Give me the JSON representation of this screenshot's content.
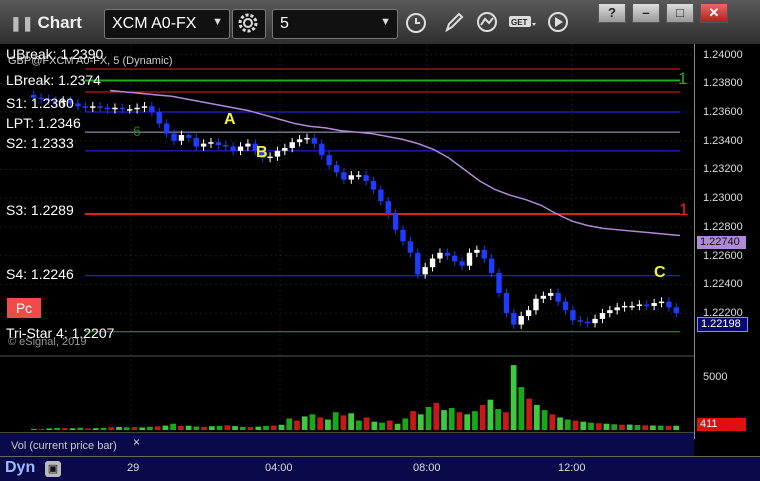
{
  "window": {
    "title": "Chart",
    "symbol": "XCM A0-FX",
    "interval": "5"
  },
  "study_label": "GBP@FXCM A0-FX, 5 (Dynamic)",
  "levels": {
    "break_top": "UBreak: 1.2390",
    "lbreak": "LBreak: 1.2374",
    "s1": "S1: 1.2360",
    "lpt": "LPT: 1.2346",
    "s2": "S2: 1.2333",
    "s3": "S3: 1.2289",
    "s4": "S4: 1.2246",
    "tristar": "Tri-Star 4: 1.2207"
  },
  "markers": {
    "a": "A",
    "b": "B",
    "c": "C",
    "one_top": "1",
    "one_mid": "1",
    "small": "6"
  },
  "badge": "Pc",
  "watermark": "© eSignal, 2019",
  "price_axis": {
    "ticks": [
      "1.24000",
      "1.23800",
      "1.23600",
      "1.23400",
      "1.23200",
      "1.23000",
      "1.22800",
      "1.22600",
      "1.22400",
      "1.22200"
    ],
    "ma_value": "1.22740",
    "last_price": "1.22198",
    "volume_tick": "5000",
    "volume_last": "411"
  },
  "volume_pane": {
    "label": "Vol (current price bar)",
    "close": "×"
  },
  "time_axis": {
    "labels": [
      "29",
      "04:00",
      "08:00",
      "12:00"
    ],
    "mode": "Dyn"
  },
  "colors": {
    "candle_up": "#ffffff",
    "candle_down": "#1e3cff",
    "ma": "#b08ad8",
    "support": "#2a2aff",
    "resistance": "#e02020",
    "break_line": "#22aa22",
    "marker_yellow": "#f4f43a"
  },
  "chart_data": {
    "type": "candlestick",
    "y_range": [
      1.2195,
      1.2406
    ],
    "price_series": [
      1.237,
      1.2369,
      1.2368,
      1.2367,
      1.2368,
      1.2366,
      1.2364,
      1.2363,
      1.2364,
      1.2363,
      1.2362,
      1.2363,
      1.2362,
      1.2362,
      1.2363,
      1.2364,
      1.236,
      1.2352,
      1.2345,
      1.234,
      1.2344,
      1.2342,
      1.2336,
      1.2338,
      1.2339,
      1.2337,
      1.2336,
      1.2333,
      1.2336,
      1.2338,
      1.2333,
      1.2328,
      1.2329,
      1.2333,
      1.2335,
      1.2339,
      1.2341,
      1.2342,
      1.2338,
      1.233,
      1.2323,
      1.2318,
      1.2313,
      1.2316,
      1.2316,
      1.2312,
      1.2306,
      1.2298,
      1.2289,
      1.2278,
      1.227,
      1.2262,
      1.2247,
      1.2252,
      1.2258,
      1.2262,
      1.226,
      1.2256,
      1.2253,
      1.2262,
      1.2264,
      1.2258,
      1.2248,
      1.2234,
      1.222,
      1.2212,
      1.2218,
      1.2222,
      1.223,
      1.2232,
      1.2234,
      1.2228,
      1.2222,
      1.2215,
      1.2214,
      1.2213,
      1.2216,
      1.222,
      1.2222,
      1.2224,
      1.2225,
      1.2225,
      1.2226,
      1.2225,
      1.2227,
      1.2228,
      1.2224,
      1.222
    ],
    "ma_series": [
      1.2375,
      1.2374,
      1.2373,
      1.2372,
      1.2371,
      1.2369,
      1.2367,
      1.2365,
      1.2363,
      1.2361,
      1.2358,
      1.2355,
      1.2352,
      1.235,
      1.2349,
      1.2347,
      1.2346,
      1.2345,
      1.2343,
      1.2341,
      1.2338,
      1.2334,
      1.2328,
      1.232,
      1.2312,
      1.2306,
      1.2302,
      1.2299,
      1.2295,
      1.2289,
      1.2284,
      1.2281,
      1.2279,
      1.2278,
      1.2277,
      1.2276,
      1.2275,
      1.2274
    ],
    "volume_series": [
      120,
      90,
      150,
      200,
      180,
      160,
      220,
      140,
      170,
      210,
      260,
      300,
      250,
      280,
      240,
      310,
      350,
      420,
      600,
      380,
      410,
      330,
      290,
      360,
      400,
      450,
      370,
      300,
      280,
      320,
      390,
      420,
      500,
      1100,
      900,
      1300,
      1500,
      1200,
      1000,
      1700,
      1400,
      1600,
      900,
      1200,
      800,
      700,
      900,
      600,
      1100,
      1800,
      1500,
      2200,
      2600,
      1900,
      2100,
      1700,
      1500,
      1800,
      2400,
      2900,
      2000,
      1700,
      6200,
      4100,
      3000,
      2400,
      1900,
      1500,
      1200,
      1000,
      900,
      800,
      700,
      650,
      600,
      550,
      500,
      520,
      480,
      450,
      430,
      420,
      400,
      411
    ],
    "volume_range": [
      0,
      6500
    ],
    "horizontal_levels": [
      {
        "name": "UBreak",
        "value": 1.239
      },
      {
        "name": "LBreak",
        "value": 1.2374
      },
      {
        "name": "S1",
        "value": 1.236
      },
      {
        "name": "LPT",
        "value": 1.2346
      },
      {
        "name": "S2",
        "value": 1.2333
      },
      {
        "name": "S3",
        "value": 1.2289
      },
      {
        "name": "S4",
        "value": 1.2246
      },
      {
        "name": "Tri-Star 4",
        "value": 1.2207
      }
    ]
  }
}
